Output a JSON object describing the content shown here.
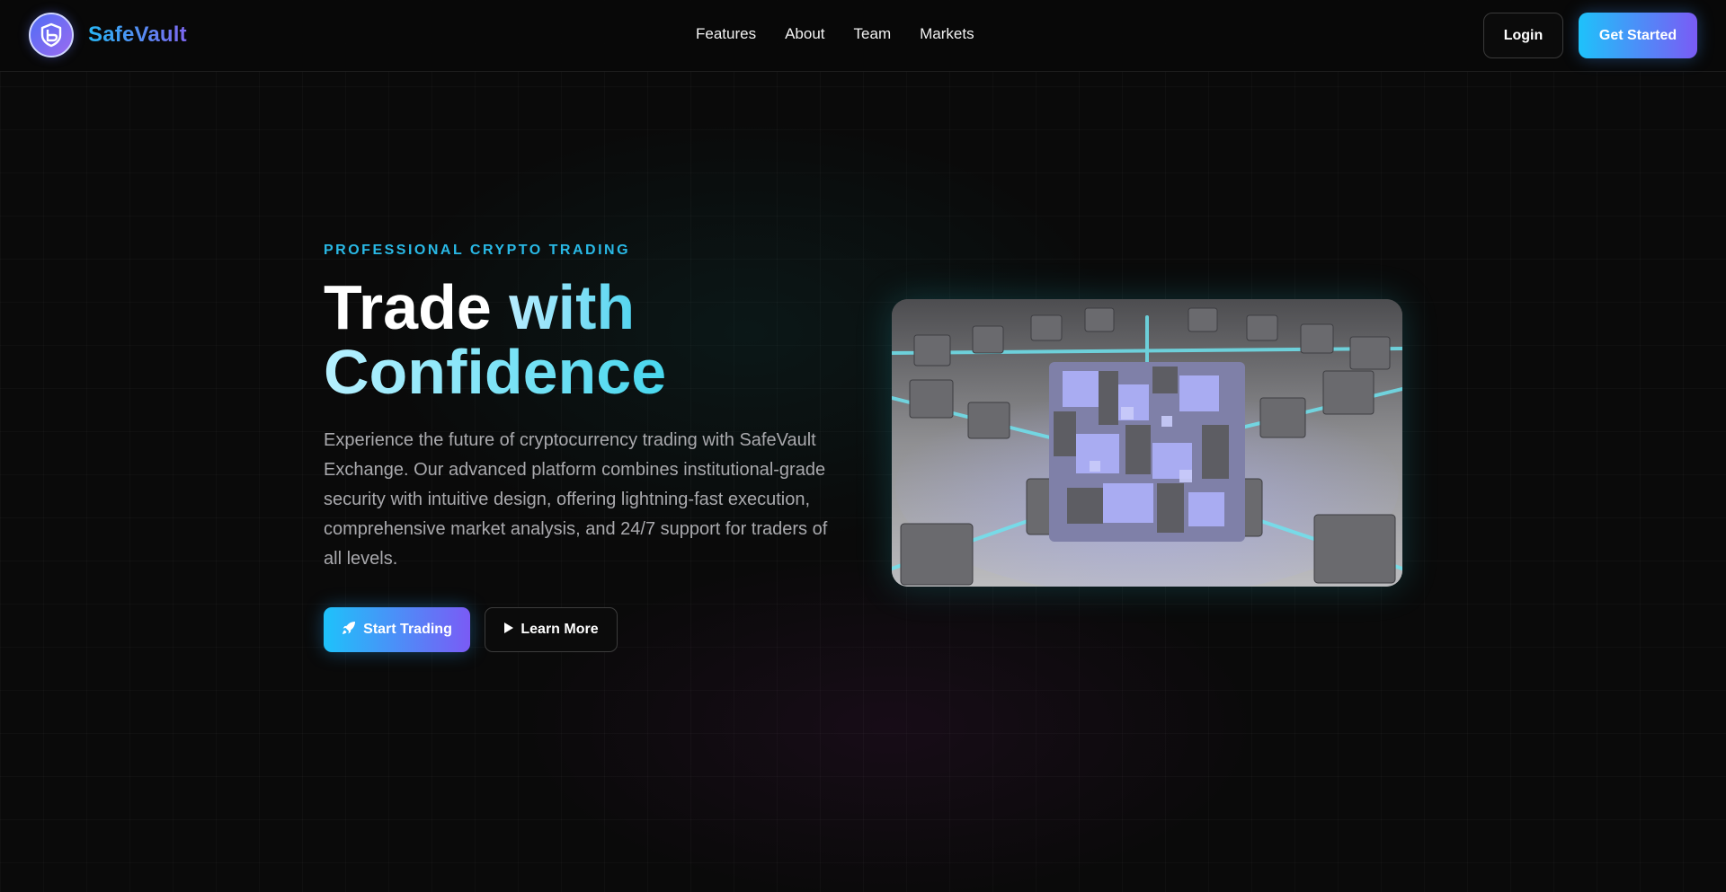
{
  "header": {
    "brand_name": "SafeVault",
    "logo_icon": "shield-b-logo-icon",
    "nav": [
      "Features",
      "About",
      "Team",
      "Markets"
    ],
    "login_label": "Login",
    "cta_label": "Get Started"
  },
  "hero": {
    "eyebrow": "PROFESSIONAL CRYPTO TRADING",
    "title_word1": "Trade ",
    "title_word2": "with",
    "title_line2": "Confidence",
    "description": "Experience the future of cryptocurrency trading with SafeVault Exchange. Our advanced platform combines institutional-grade security with intuitive design, offering lightning-fast execution, comprehensive market analysis, and 24/7 support for traders of all levels.",
    "primary_button": "Start Trading",
    "primary_icon": "rocket-icon",
    "secondary_button": "Learn More",
    "secondary_icon": "play-icon"
  },
  "colors": {
    "background": "#0a0a0a",
    "accent_cyan": "#1ec2fa",
    "accent_violet": "#7a5bf5",
    "eyebrow": "#29b9e6",
    "body_text": "#a9a9ad"
  }
}
